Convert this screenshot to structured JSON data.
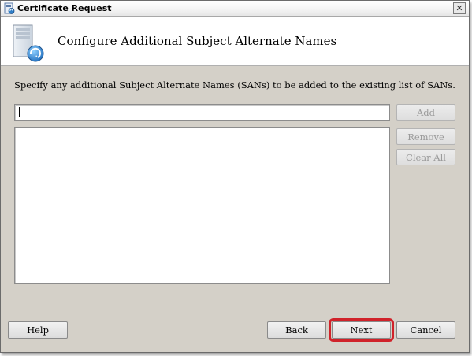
{
  "window": {
    "title": "Certificate Request",
    "close_glyph": "✕"
  },
  "header": {
    "title": "Configure Additional Subject Alternate Names",
    "icon": "certificate-server-icon"
  },
  "instructions": "Specify any additional Subject Alternate Names (SANs) to be added to the existing list of SANs.",
  "san_input": {
    "value": "",
    "placeholder": ""
  },
  "san_list": {
    "items": []
  },
  "side_buttons": {
    "add": "Add",
    "remove": "Remove",
    "clear_all": "Clear All"
  },
  "footer_buttons": {
    "help": "Help",
    "back": "Back",
    "next": "Next",
    "cancel": "Cancel"
  },
  "colors": {
    "dialog_background": "#d4d0c8",
    "highlight": "#d0222a"
  }
}
